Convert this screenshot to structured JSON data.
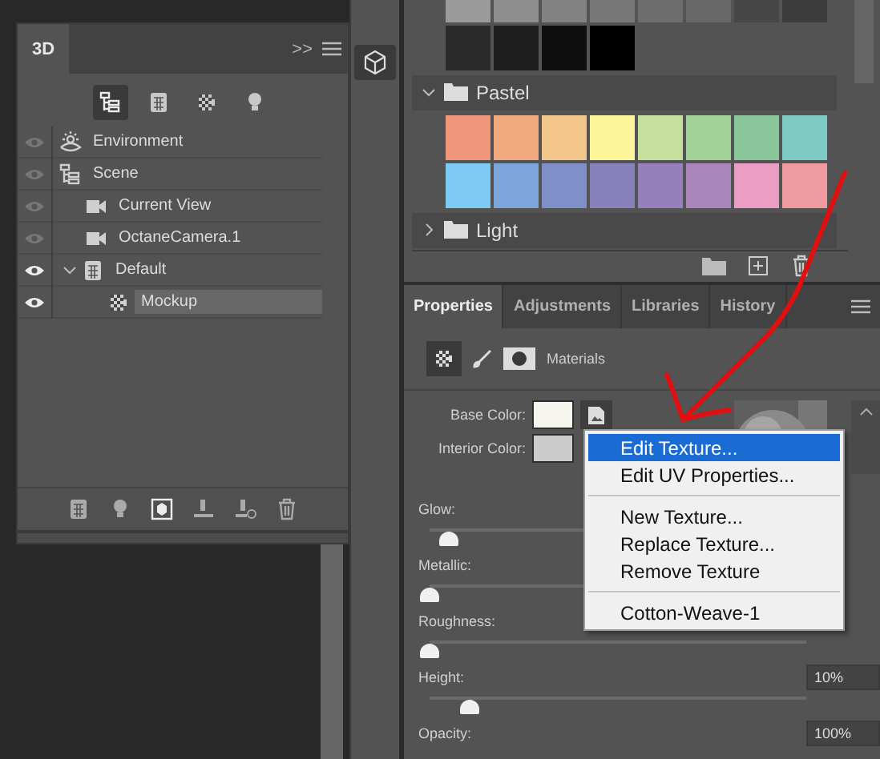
{
  "panel_3d": {
    "tab": "3D",
    "overflow": ">>",
    "toolbar": [
      {
        "kind": "scene",
        "selected": true
      },
      {
        "kind": "mesh",
        "selected": false
      },
      {
        "kind": "material",
        "selected": false
      },
      {
        "kind": "light",
        "selected": false
      }
    ],
    "tree": [
      {
        "label": "Environment",
        "kind": "environment",
        "visible": false,
        "selected": false
      },
      {
        "label": "Scene",
        "kind": "scene",
        "visible": false,
        "selected": false,
        "children": [
          {
            "label": "Current View",
            "kind": "camera",
            "visible": false,
            "selected": false
          },
          {
            "label": "OctaneCamera.1",
            "kind": "camera",
            "visible": false,
            "selected": false
          },
          {
            "label": "Default",
            "kind": "mesh",
            "visible": true,
            "selected": false,
            "expanded": true,
            "children": [
              {
                "label": "Mockup",
                "kind": "material",
                "visible": true,
                "selected": false,
                "highlighted": true
              }
            ]
          }
        ]
      }
    ]
  },
  "swatches": {
    "rows": [
      [
        {
          "color": "#9a9a9a"
        },
        {
          "color": "#8e8e8e"
        },
        {
          "color": "#828282"
        },
        {
          "color": "#777777"
        },
        {
          "color": "#6d6d6d"
        },
        {
          "color": "#686868"
        },
        {
          "color": "#464646"
        },
        {
          "color": "#3c3c3c"
        }
      ],
      [
        {
          "color": "#2b2b2b"
        },
        {
          "color": "#1e1e1e"
        },
        {
          "color": "#0f0f0f"
        },
        {
          "color": "#000000"
        }
      ]
    ],
    "groups": [
      {
        "name": "Pastel",
        "expanded": true,
        "rows": [
          [
            {
              "color": "#ee957a"
            },
            {
              "color": "#f1aa80"
            },
            {
              "color": "#f5c68c"
            },
            {
              "color": "#fdf59a"
            },
            {
              "color": "#c6df9d"
            },
            {
              "color": "#a4d29b"
            },
            {
              "color": "#89c79b"
            },
            {
              "color": "#7dc9c3"
            }
          ],
          [
            {
              "color": "#7dcaf2"
            },
            {
              "color": "#7da6da"
            },
            {
              "color": "#7f8fc8"
            },
            {
              "color": "#8781bb"
            },
            {
              "color": "#957fbc"
            },
            {
              "color": "#ab86bc"
            },
            {
              "color": "#eb9dc4"
            },
            {
              "color": "#ef9a9e"
            }
          ]
        ]
      },
      {
        "name": "Light",
        "expanded": false
      }
    ]
  },
  "properties": {
    "tabs": [
      {
        "label": "Properties",
        "selected": true
      },
      {
        "label": "Adjustments",
        "selected": false
      },
      {
        "label": "Libraries",
        "selected": false
      },
      {
        "label": "History",
        "selected": false
      }
    ],
    "section": "Materials",
    "colors": [
      {
        "label": "Base Color:",
        "color": "#f6f5ee",
        "texture": true
      },
      {
        "label": "Interior Color:",
        "color": "#cccccc",
        "texture": false
      }
    ],
    "sliders": [
      {
        "label": "Glow:",
        "level": 0.05
      },
      {
        "label": "Metallic:",
        "level": 0
      },
      {
        "label": "Roughness:",
        "level": 0
      },
      {
        "label": "Height:",
        "level": 0.1,
        "value": "10%"
      },
      {
        "label": "Opacity:",
        "value": "100%"
      }
    ]
  },
  "menu": {
    "groups": [
      [
        {
          "label": "Edit Texture...",
          "selected": true
        },
        {
          "label": "Edit UV Properties...",
          "selected": false
        }
      ],
      [
        {
          "label": "New Texture...",
          "selected": false
        },
        {
          "label": "Replace Texture...",
          "selected": false
        },
        {
          "label": "Remove Texture",
          "selected": false
        }
      ],
      [
        {
          "label": "Cotton-Weave-1",
          "selected": false
        }
      ]
    ]
  }
}
